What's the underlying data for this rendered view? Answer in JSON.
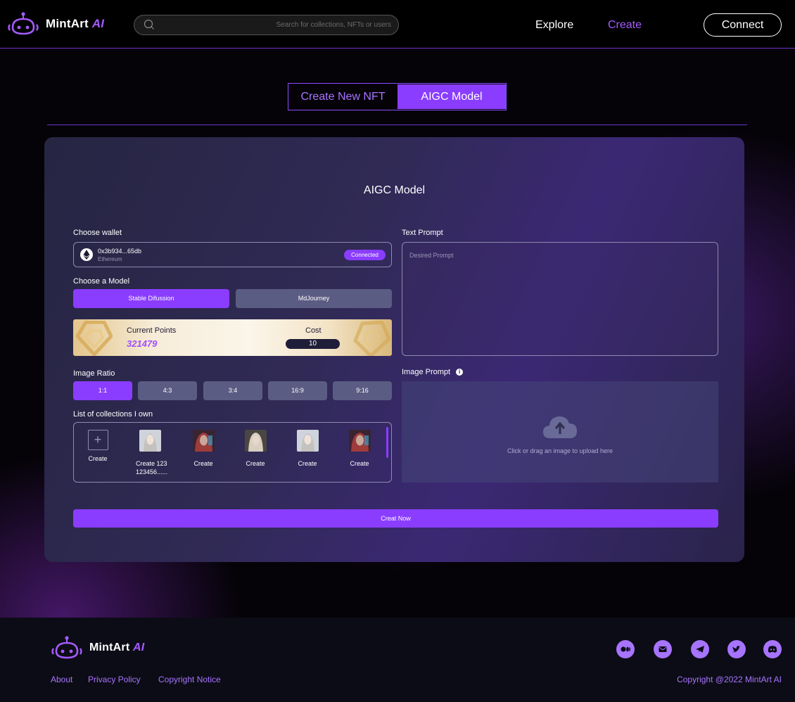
{
  "header": {
    "brand": "MintArt",
    "brand_suffix": "AI",
    "search_placeholder": "Search for collections, NFTs or users",
    "nav_explore": "Explore",
    "nav_create": "Create",
    "connect": "Connect"
  },
  "tabs": {
    "create_new": "Create New NFT",
    "aigc": "AIGC Model"
  },
  "card": {
    "title": "AIGC Model",
    "choose_wallet": "Choose wallet",
    "wallet_address": "0x3b934...65db",
    "wallet_chain": "Ethereum",
    "connected": "Connected",
    "choose_model": "Choose a Model",
    "models": [
      "Stable  Difussion",
      "MdJourney"
    ],
    "current_points_label": "Current Points",
    "current_points": "321479",
    "cost_label": "Cost",
    "cost": "10",
    "image_ratio": "Image Ratio",
    "ratios": [
      "1:1",
      "4:3",
      "3:4",
      "16:9",
      "9:16"
    ],
    "collections_label": "List of collections I own",
    "collections": [
      {
        "label": "Create",
        "type": "add"
      },
      {
        "label": "Create 123 123456......",
        "type": "thumb"
      },
      {
        "label": "Create",
        "type": "thumb"
      },
      {
        "label": "Create",
        "type": "thumb"
      },
      {
        "label": "Create",
        "type": "thumb"
      },
      {
        "label": "Create",
        "type": "thumb"
      }
    ],
    "text_prompt_label": "Text Prompt",
    "text_prompt_placeholder": "Desired Prompt",
    "image_prompt_label": "Image Prompt",
    "upload_text": "Click or drag an image to upload here",
    "create_now": "Creat  Now"
  },
  "footer": {
    "brand": "MintArt",
    "brand_suffix": "AI",
    "links": [
      "About",
      "Privacy Policy",
      "Copyright Notice"
    ],
    "copyright": "Copyright @2022 MintArt AI",
    "social_icons": [
      "medium-icon",
      "email-icon",
      "telegram-icon",
      "twitter-icon",
      "discord-icon"
    ]
  },
  "colors": {
    "accent": "#8a3dff",
    "accent_light": "#a774ff",
    "card_bg": "#2c2850"
  }
}
